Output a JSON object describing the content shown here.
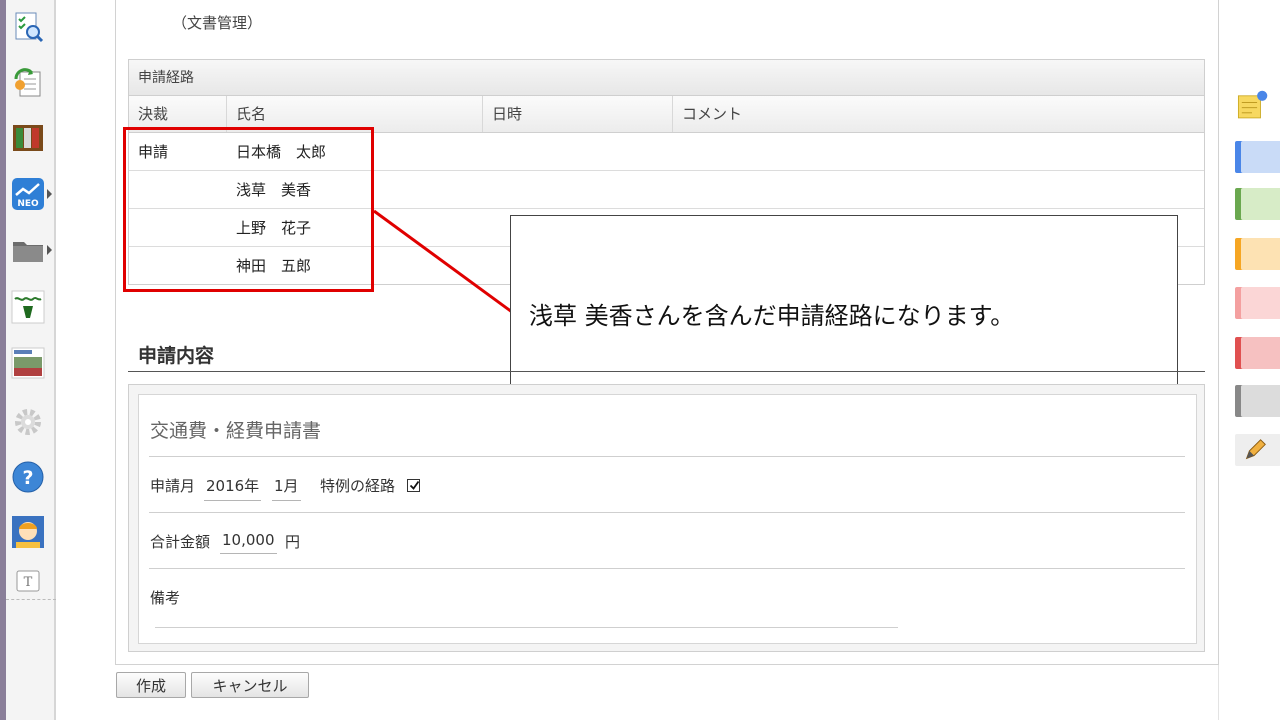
{
  "header": {
    "category_label": "（文書管理）"
  },
  "route_table": {
    "title": "申請経路",
    "columns": [
      "決裁",
      "氏名",
      "日時",
      "コメント"
    ],
    "rows": [
      {
        "decision": "申請",
        "name": "日本橋　太郎",
        "datetime": "",
        "comment": ""
      },
      {
        "decision": "",
        "name": "浅草　美香",
        "datetime": "",
        "comment": ""
      },
      {
        "decision": "",
        "name": "上野　花子",
        "datetime": "",
        "comment": ""
      },
      {
        "decision": "",
        "name": "神田　五郎",
        "datetime": "",
        "comment": ""
      }
    ]
  },
  "callout": {
    "text": "浅草 美香さんを含んだ申請経路になります。"
  },
  "content_section": {
    "title": "申請内容",
    "form": {
      "title": "交通費・経費申請書",
      "month_label": "申請月",
      "year_value": "2016年",
      "month_value": "1月",
      "special_route_label": "特例の経路",
      "special_route_checked": true,
      "total_label": "合計金額",
      "total_value": "10,000",
      "total_unit": "円",
      "remarks_label": "備考",
      "remarks_value": ""
    }
  },
  "buttons": {
    "create_label": "作成",
    "cancel_label": "キャンセル"
  },
  "colors": {
    "highlight": "#e00000",
    "rail_blue": "#4a86e8",
    "rail_green": "#6aa84f",
    "rail_orange": "#f6a623",
    "rail_pink": "#f4a0a0",
    "rail_red": "#e05050",
    "rail_gray": "#888888"
  },
  "icons": {
    "dock": [
      "checklist-search-icon",
      "document-refresh-icon",
      "binders-icon",
      "neo-chart-icon",
      "folder-icon",
      "tanomeru-icon",
      "news-image-icon",
      "settings-gear-icon",
      "help-icon",
      "support-operator-icon",
      "text-tool-icon"
    ],
    "rail": [
      "sticky-note-icon",
      "pencil-icon"
    ]
  }
}
